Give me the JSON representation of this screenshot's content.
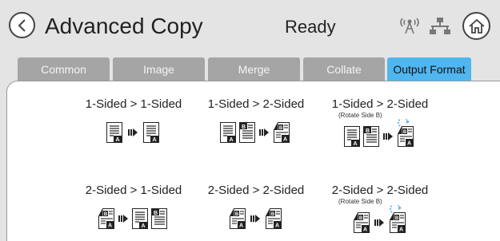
{
  "header": {
    "title": "Advanced Copy",
    "status": "Ready",
    "icons": {
      "back": "back-arrow-icon",
      "wireless": "wireless-icon",
      "network": "wired-network-icon",
      "home": "home-icon"
    }
  },
  "tabs": [
    {
      "label": "Common",
      "active": false
    },
    {
      "label": "Image",
      "active": false
    },
    {
      "label": "Merge",
      "active": false
    },
    {
      "label": "Collate",
      "active": false
    },
    {
      "label": "Output Format",
      "active": true
    }
  ],
  "options": [
    {
      "label": "1-Sided > 1-Sided",
      "sub": ""
    },
    {
      "label": "1-Sided > 2-Sided",
      "sub": ""
    },
    {
      "label": "1-Sided > 2-Sided",
      "sub": "(Rotate Side B)"
    },
    {
      "label": "2-Sided > 1-Sided",
      "sub": ""
    },
    {
      "label": "2-Sided > 2-Sided",
      "sub": ""
    },
    {
      "label": "2-Sided > 2-Sided",
      "sub": "(Rotate Side B)"
    }
  ],
  "colors": {
    "active_tab": "#4fb6f0",
    "inactive_tab": "#a5a5a5",
    "header_bg": "#e4e4e4",
    "rotate_accent": "#6ab4e8"
  }
}
